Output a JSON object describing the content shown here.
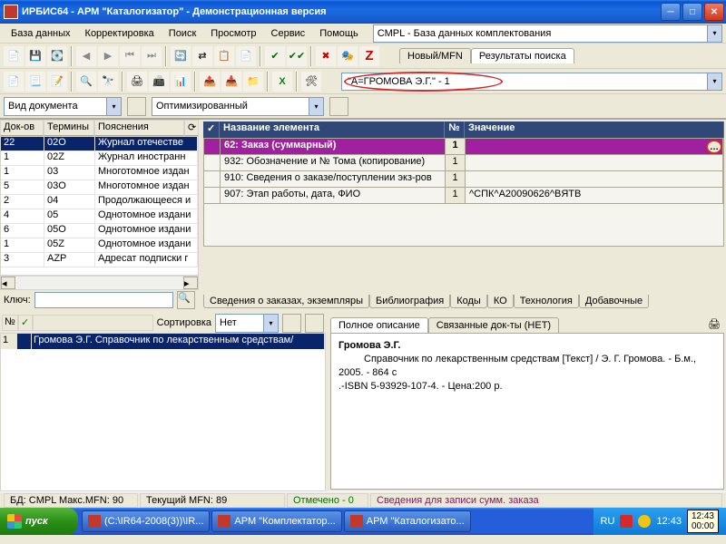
{
  "window": {
    "title": "ИРБИС64 - АРМ \"Каталогизатор\" - Демонстрационная версия"
  },
  "menu": {
    "items": [
      "База данных",
      "Корректировка",
      "Поиск",
      "Просмотр",
      "Сервис",
      "Помощь"
    ],
    "db_selected": "CMPL - База данных комплектования"
  },
  "toolbar2": {
    "tabs": {
      "new": "Новый/MFN",
      "results": "Результаты поиска"
    },
    "search_value": "\"A=ГРОМОВА Э.Г.\" - 1"
  },
  "selectors": {
    "view_doc": "Вид документа",
    "optimized": "Оптимизированный"
  },
  "dictionary": {
    "headers": [
      "Док-ов",
      "Термины",
      "Пояснения"
    ],
    "rows": [
      {
        "c": "22",
        "t": "02O",
        "p": "Журнал отечестве",
        "sel": true
      },
      {
        "c": "1",
        "t": "02Z",
        "p": "Журнал иностранн"
      },
      {
        "c": "1",
        "t": "03",
        "p": "Многотомное издан"
      },
      {
        "c": "5",
        "t": "03O",
        "p": "Многотомное издан"
      },
      {
        "c": "2",
        "t": "04",
        "p": "Продолжающееся и"
      },
      {
        "c": "4",
        "t": "05",
        "p": "Однотомное издани"
      },
      {
        "c": "6",
        "t": "05O",
        "p": "Однотомное издани"
      },
      {
        "c": "1",
        "t": "05Z",
        "p": "Однотомное издани"
      },
      {
        "c": "3",
        "t": "AZP",
        "p": "Адресат подписки г"
      }
    ],
    "key_label": "Ключ:"
  },
  "fields": {
    "headers": {
      "check": "✓",
      "name": "Название элемента",
      "num": "№",
      "value": "Значение"
    },
    "rows": [
      {
        "name": "62: Заказ (суммарный)",
        "num": "1",
        "value": "",
        "hl": true
      },
      {
        "name": "932: Обозначение и № Тома (копирование)",
        "num": "1",
        "value": ""
      },
      {
        "name": "910: Сведения о заказе/поступлении экз-ров",
        "num": "1",
        "value": ""
      },
      {
        "name": "907: Этап работы, дата, ФИО",
        "num": "1",
        "value": "^CПК^A20090626^BЯТВ"
      }
    ],
    "btabs": [
      "Сведения о заказах, экземпляры",
      "Библиография",
      "Коды",
      "КО",
      "Технология",
      "Добавочные"
    ]
  },
  "results": {
    "sort_label": "Сортировка",
    "sort_value": "Нет",
    "headers": {
      "n": "№",
      "c": "✓",
      "t": ""
    },
    "rows": [
      {
        "n": "1",
        "c": "",
        "t": "Громова Э.Г. Справочник по лекарственным средствам/"
      }
    ]
  },
  "description": {
    "tabs": {
      "full": "Полное описание",
      "linked": "Связанные док-ты (НЕТ)"
    },
    "author": "Громова Э.Г.",
    "body_line1": "Справочник по лекарственным средствам [Текст] / Э. Г. Громова. - Б.м., 2005. - 864 с",
    "body_line2": ".-ISBN 5-93929-107-4. - Цена:200 р."
  },
  "status": {
    "db": "БД: CMPL Макс.MFN: 90",
    "cur": "Текущий MFN: 89",
    "marked": "Отмечено - 0",
    "hint": "Сведения для записи сумм. заказа"
  },
  "taskbar": {
    "start": "пуск",
    "tasks": [
      "(C:\\IR64-2008(3))\\IR...",
      "АРМ \"Комплектатор...",
      "АРМ \"Каталогизато..."
    ],
    "time": "12:43",
    "lang": "RU",
    "tip": "12:43\n00:00"
  }
}
